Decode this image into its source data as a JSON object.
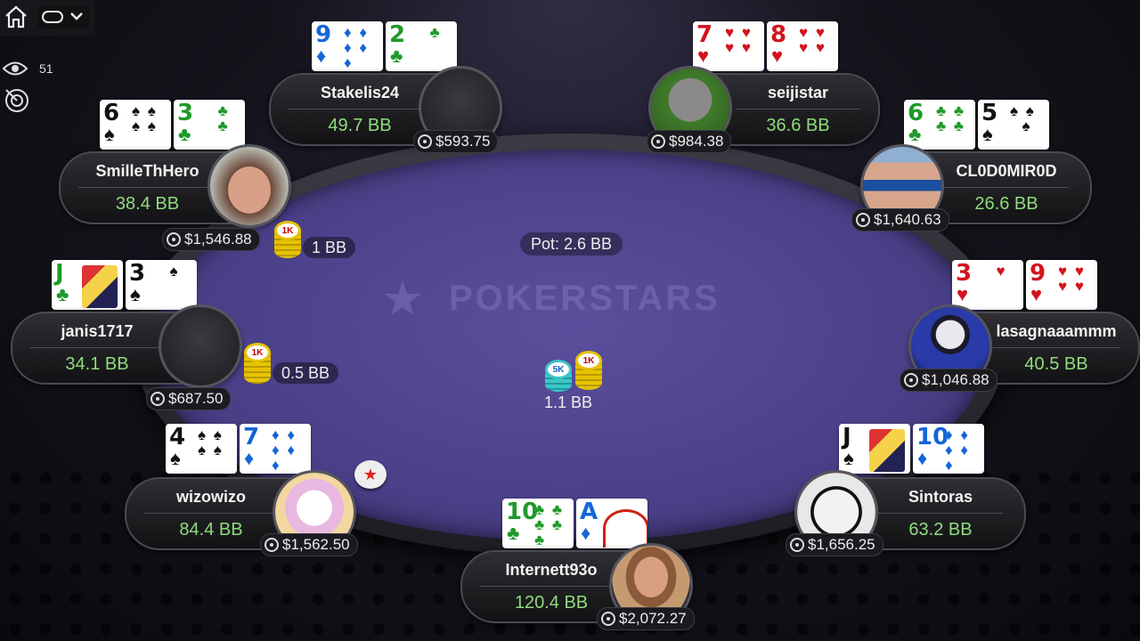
{
  "viewers": "51",
  "pot_label": "Pot: 2.6 BB",
  "center_bet": "1.1 BB",
  "center_chips": [
    "5K",
    "1K"
  ],
  "logo_text": "POKERSTARS",
  "colors": {
    "felt": "#4a4088",
    "stack_green": "#8fdc7a",
    "chip_gold": "#e7c200"
  },
  "seats": {
    "stakelis": {
      "name": "Stakelis24",
      "stack": "49.7 BB",
      "money": "$593.75",
      "cards": [
        {
          "rank": "9",
          "suit": "♦",
          "color": "blue"
        },
        {
          "rank": "2",
          "suit": "♣",
          "color": "green"
        }
      ]
    },
    "seijistar": {
      "name": "seijistar",
      "stack": "36.6 BB",
      "money": "$984.38",
      "cards": [
        {
          "rank": "7",
          "suit": "♥",
          "color": "red"
        },
        {
          "rank": "8",
          "suit": "♥",
          "color": "red"
        }
      ]
    },
    "smille": {
      "name": "SmilleThHero",
      "stack": "38.4 BB",
      "money": "$1,546.88",
      "bet": "1 BB",
      "chip": "1K",
      "cards": [
        {
          "rank": "6",
          "suit": "♠",
          "color": "black"
        },
        {
          "rank": "3",
          "suit": "♣",
          "color": "green"
        }
      ]
    },
    "cl0d": {
      "name": "CL0D0MIR0D",
      "stack": "26.6 BB",
      "money": "$1,640.63",
      "cards": [
        {
          "rank": "6",
          "suit": "♣",
          "color": "green"
        },
        {
          "rank": "5",
          "suit": "♠",
          "color": "black"
        }
      ]
    },
    "janis": {
      "name": "janis1717",
      "stack": "34.1 BB",
      "money": "$687.50",
      "bet": "0.5 BB",
      "chip": "1K",
      "cards": [
        {
          "rank": "J",
          "suit": "♣",
          "color": "green"
        },
        {
          "rank": "3",
          "suit": "♠",
          "color": "black"
        }
      ]
    },
    "lasagna": {
      "name": "lasagnaaammm",
      "stack": "40.5 BB",
      "money": "$1,046.88",
      "cards": [
        {
          "rank": "3",
          "suit": "♥",
          "color": "red"
        },
        {
          "rank": "9",
          "suit": "♥",
          "color": "red"
        }
      ]
    },
    "wizo": {
      "name": "wizowizo",
      "stack": "84.4 BB",
      "money": "$1,562.50",
      "cards": [
        {
          "rank": "4",
          "suit": "♠",
          "color": "black"
        },
        {
          "rank": "7",
          "suit": "♦",
          "color": "blue"
        }
      ]
    },
    "sintoras": {
      "name": "Sintoras",
      "stack": "63.2 BB",
      "money": "$1,656.25",
      "cards": [
        {
          "rank": "J",
          "suit": "♠",
          "color": "black"
        },
        {
          "rank": "10",
          "suit": "♦",
          "color": "blue"
        }
      ]
    },
    "internett": {
      "name": "Internett93o",
      "stack": "120.4 BB",
      "money": "$2,072.27",
      "cards": [
        {
          "rank": "10",
          "suit": "♣",
          "color": "green"
        },
        {
          "rank": "A",
          "suit": "♦",
          "color": "blue"
        }
      ]
    }
  }
}
